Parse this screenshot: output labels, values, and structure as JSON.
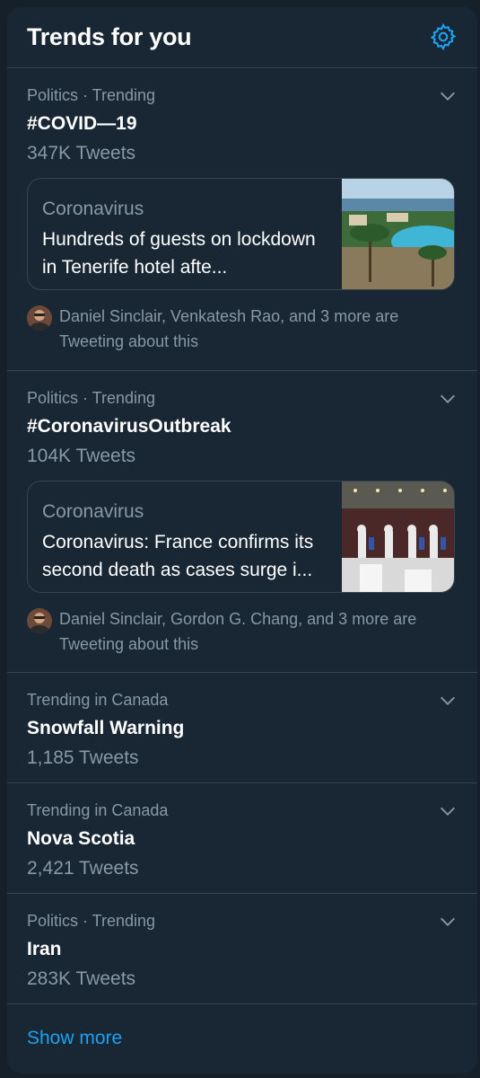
{
  "panel": {
    "title": "Trends for you",
    "settings_icon": "gear-icon",
    "accent_color": "#1da1f2"
  },
  "trends": [
    {
      "meta": "Politics · Trending",
      "name": "#COVID—19",
      "count": "347K Tweets",
      "card": {
        "topic": "Coronavirus",
        "headline": "Hundreds of guests on lockdown in Tenerife hotel afte..."
      },
      "social": "Daniel Sinclair, Venkatesh Rao, and 3 more are Tweeting about this"
    },
    {
      "meta": "Politics · Trending",
      "name": "#CoronavirusOutbreak",
      "count": "104K Tweets",
      "card": {
        "topic": "Coronavirus",
        "headline": "Coronavirus: France confirms its second death as cases surge i..."
      },
      "social": "Daniel Sinclair, Gordon G. Chang, and 3 more are Tweeting about this"
    },
    {
      "meta": "Trending in Canada",
      "name": "Snowfall Warning",
      "count": "1,185 Tweets"
    },
    {
      "meta": "Trending in Canada",
      "name": "Nova Scotia",
      "count": "2,421 Tweets"
    },
    {
      "meta": "Politics · Trending",
      "name": "Iran",
      "count": "283K Tweets"
    }
  ],
  "footer": {
    "show_more": "Show more"
  }
}
